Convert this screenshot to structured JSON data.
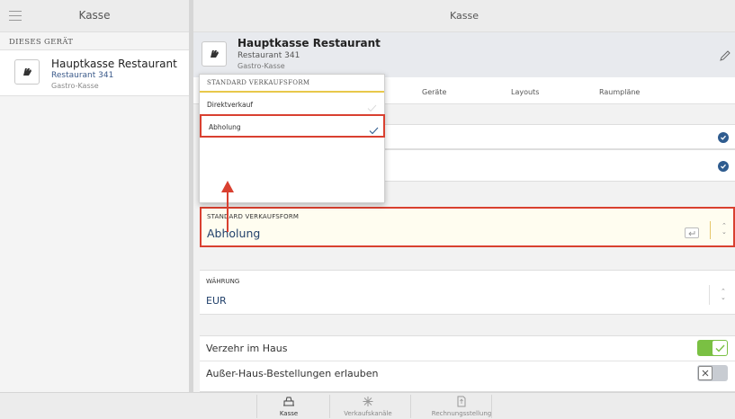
{
  "left_pane": {
    "title": "Kasse",
    "section_label": "DIESES GERÄT",
    "device": {
      "name": "Hauptkasse Restaurant",
      "location": "Restaurant 341",
      "type": "Gastro-Kasse"
    }
  },
  "right_pane": {
    "title": "Kasse",
    "header": {
      "name": "Hauptkasse Restaurant",
      "location": "Restaurant 341",
      "type": "Gastro-Kasse"
    },
    "tabs": [
      "Geräte",
      "Layouts",
      "Raumpläne"
    ],
    "default_sales_form": {
      "label": "STANDARD VERKAUFSFORM",
      "value": "Abholung"
    },
    "currency": {
      "label": "WÄHRUNG",
      "value": "EUR"
    },
    "toggles": [
      {
        "label": "Verzehr im Haus",
        "on": true
      },
      {
        "label": "Außer-Haus-Bestellungen erlauben",
        "on": false
      }
    ]
  },
  "dropdown": {
    "header": "STANDARD VERKAUFSFORM",
    "options": [
      {
        "label": "Direktverkauf",
        "selected": false
      },
      {
        "label": "Abholung",
        "selected": true
      }
    ]
  },
  "bottom_tabs": [
    {
      "label": "Kasse",
      "icon": "register-icon",
      "active": true
    },
    {
      "label": "Verkaufskanäle",
      "icon": "channels-icon",
      "active": false
    },
    {
      "label": "Rechnungsstellung",
      "icon": "invoice-icon",
      "active": false
    }
  ],
  "colors": {
    "highlight_border": "#d94030",
    "accent_blue": "#2f5c8f",
    "toggle_on": "#7ac043",
    "selected_row_bg": "#fffdf0"
  }
}
